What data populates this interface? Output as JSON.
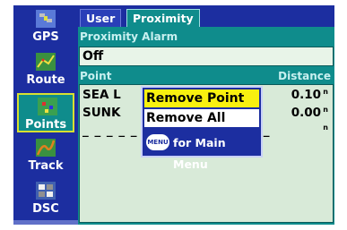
{
  "sidebar": {
    "items": [
      {
        "label": "GPS",
        "icon": "satellite-icon"
      },
      {
        "label": "Route",
        "icon": "route-icon"
      },
      {
        "label": "Points",
        "icon": "points-icon"
      },
      {
        "label": "Track",
        "icon": "track-icon"
      },
      {
        "label": "DSC",
        "icon": "dsc-icon"
      }
    ],
    "active": "Points"
  },
  "tabs": [
    {
      "label": "User"
    },
    {
      "label": "Proximity"
    }
  ],
  "proximity": {
    "alarm_label": "Proximity Alarm",
    "alarm_value": "Off",
    "col_point": "Point",
    "col_distance": "Distance",
    "rows": [
      {
        "name": "SEA L",
        "distance": "0.10",
        "unit": "n"
      },
      {
        "name": "SUNK",
        "distance": "0.00",
        "unit": "n"
      },
      {
        "dashes": "_ _ _ _ _ _ _ _ _ _ _ _ _ _ _ _",
        "unit": "n"
      }
    ]
  },
  "menu": {
    "items": [
      "Remove Point",
      "Remove All"
    ],
    "selected": "Remove Point",
    "key_label": "MENU",
    "hint": "for Main Menu"
  },
  "colors": {
    "screen_bg": "#1c2ea0",
    "teal": "#0f8c8c",
    "highlight": "#f8f010"
  }
}
